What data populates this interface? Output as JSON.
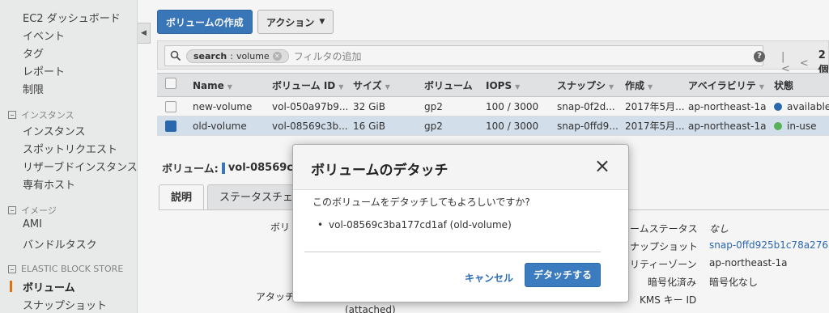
{
  "sidebar": {
    "items": [
      {
        "label": "EC2 ダッシュボード"
      },
      {
        "label": "イベント"
      },
      {
        "label": "タグ"
      },
      {
        "label": "レポート"
      },
      {
        "label": "制限"
      }
    ],
    "sections": [
      {
        "header": "インスタンス",
        "items": [
          "インスタンス",
          "スポットリクエスト",
          "リザーブドインスタンス",
          "専有ホスト"
        ]
      },
      {
        "header": "イメージ",
        "items": [
          "AMI",
          "バンドルタスク"
        ]
      },
      {
        "header": "ELASTIC BLOCK STORE",
        "items": [
          "ボリューム",
          "スナップショット"
        ]
      }
    ],
    "active_item": "ボリューム"
  },
  "toolbar": {
    "create_label": "ボリュームの作成",
    "action_label": "アクション"
  },
  "filter": {
    "chip_key": "search",
    "chip_sep": " : ",
    "chip_value": "volume",
    "placeholder": "フィルタの追加",
    "count": "2 個"
  },
  "table": {
    "headers": [
      "Name",
      "ボリューム ID",
      "サイズ",
      "ボリューム",
      "IOPS",
      "スナップシ",
      "作成",
      "アベイラビリテ",
      "状態"
    ],
    "rows": [
      {
        "name": "new-volume",
        "id": "vol-050a97b9...",
        "size": "32 GiB",
        "type": "gp2",
        "iops": "100 / 3000",
        "snapshot": "snap-0f2d...",
        "created": "2017年5月...",
        "az": "ap-northeast-1a",
        "state": "available",
        "state_color": "#2c6cb5",
        "selected": false
      },
      {
        "name": "old-volume",
        "id": "vol-08569c3b...",
        "size": "16 GiB",
        "type": "gp2",
        "iops": "100 / 3000",
        "snapshot": "snap-0ffd9...",
        "created": "2017年5月...",
        "az": "ap-northeast-1a",
        "state": "in-use",
        "state_color": "#5cb85c",
        "selected": true
      }
    ]
  },
  "detail": {
    "title_prefix": "ボリューム:",
    "title_id": "vol-08569c3ba",
    "tabs": [
      "説明",
      "ステータスチェッ"
    ],
    "left_labels": [
      "ボリ",
      "アタッチ"
    ],
    "attached": "(attached)",
    "right_rows": [
      {
        "label": "ームステータス",
        "value": "なし",
        "link": false
      },
      {
        "label": "ナップショット",
        "value": "snap-0ffd925b1c78a2763",
        "link": true
      },
      {
        "label": "リティーゾーン",
        "value": "ap-northeast-1a",
        "link": false
      },
      {
        "label": "暗号化済み",
        "value": "暗号化なし",
        "link": false
      },
      {
        "label": "KMS キー ID",
        "value": "",
        "link": false
      }
    ]
  },
  "modal": {
    "title": "ボリュームのデタッチ",
    "close_glyph": "×",
    "message": "このボリュームをデタッチしてもよろしいですか?",
    "item": "vol-08569c3ba177cd1af (old-volume)",
    "cancel_label": "キャンセル",
    "confirm_label": "デタッチする"
  }
}
